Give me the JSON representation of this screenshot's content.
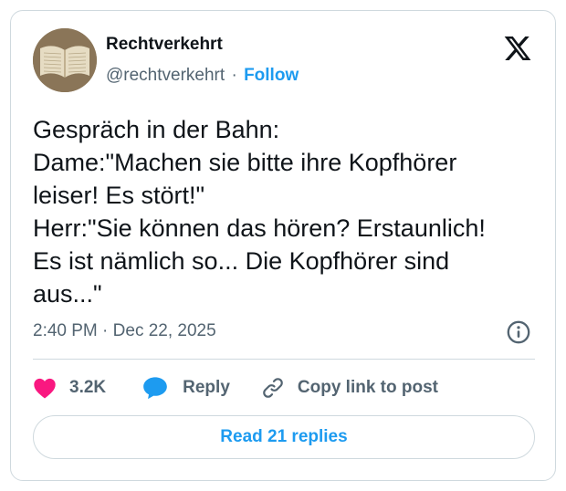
{
  "author": {
    "name": "Rechtverkehrt",
    "handle": "@rechtverkehrt",
    "separator": "·",
    "follow_label": "Follow"
  },
  "logo_icon": "x-logo-icon",
  "tweet": {
    "lines": [
      "Gespräch in der Bahn:",
      "Dame:\"Machen sie bitte ihre Kopfhörer",
      "leiser! Es stört!\"",
      "Herr:\"Sie können das hören? Erstaunlich!",
      "Es ist nämlich so... Die Kopfhörer sind",
      "aus...\""
    ]
  },
  "meta": {
    "time": "2:40 PM",
    "separator": "·",
    "date": "Dec 22, 2025",
    "info_icon": "info-icon"
  },
  "actions": {
    "like_count": "3.2K",
    "like_icon": "heart-icon",
    "reply_label": "Reply",
    "reply_icon": "speech-bubble-icon",
    "copy_label": "Copy link to post",
    "copy_icon": "link-icon"
  },
  "read_replies_label": "Read 21 replies",
  "colors": {
    "accent": "#1d9bf0",
    "like": "#f91880",
    "secondary_text": "#536471",
    "border": "#cfd9de"
  }
}
